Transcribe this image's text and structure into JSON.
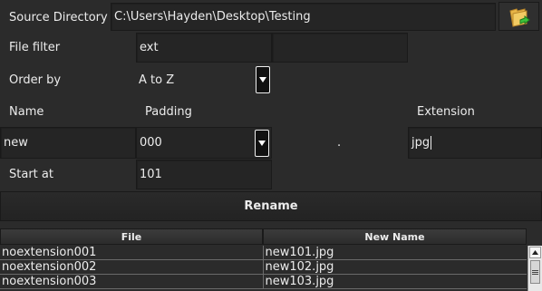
{
  "source": {
    "label": "Source Directory",
    "path": "C:\\Users\\Hayden\\Desktop\\Testing",
    "browse_icon": "folder-icon"
  },
  "filter": {
    "label": "File filter",
    "value": "ext",
    "value2": ""
  },
  "order": {
    "label": "Order by",
    "selected": "A to Z"
  },
  "headers": {
    "name": "Name",
    "padding": "Padding",
    "extension": "Extension"
  },
  "pattern": {
    "name": "new",
    "padding": "000",
    "dot": ".",
    "extension": "jpg"
  },
  "start": {
    "label": "Start at",
    "value": "101"
  },
  "rename_label": "Rename",
  "table": {
    "columns": [
      "File",
      "New Name"
    ],
    "rows": [
      [
        "noextension001",
        "new101.jpg"
      ],
      [
        "noextension002",
        "new102.jpg"
      ],
      [
        "noextension003",
        "new103.jpg"
      ]
    ]
  }
}
